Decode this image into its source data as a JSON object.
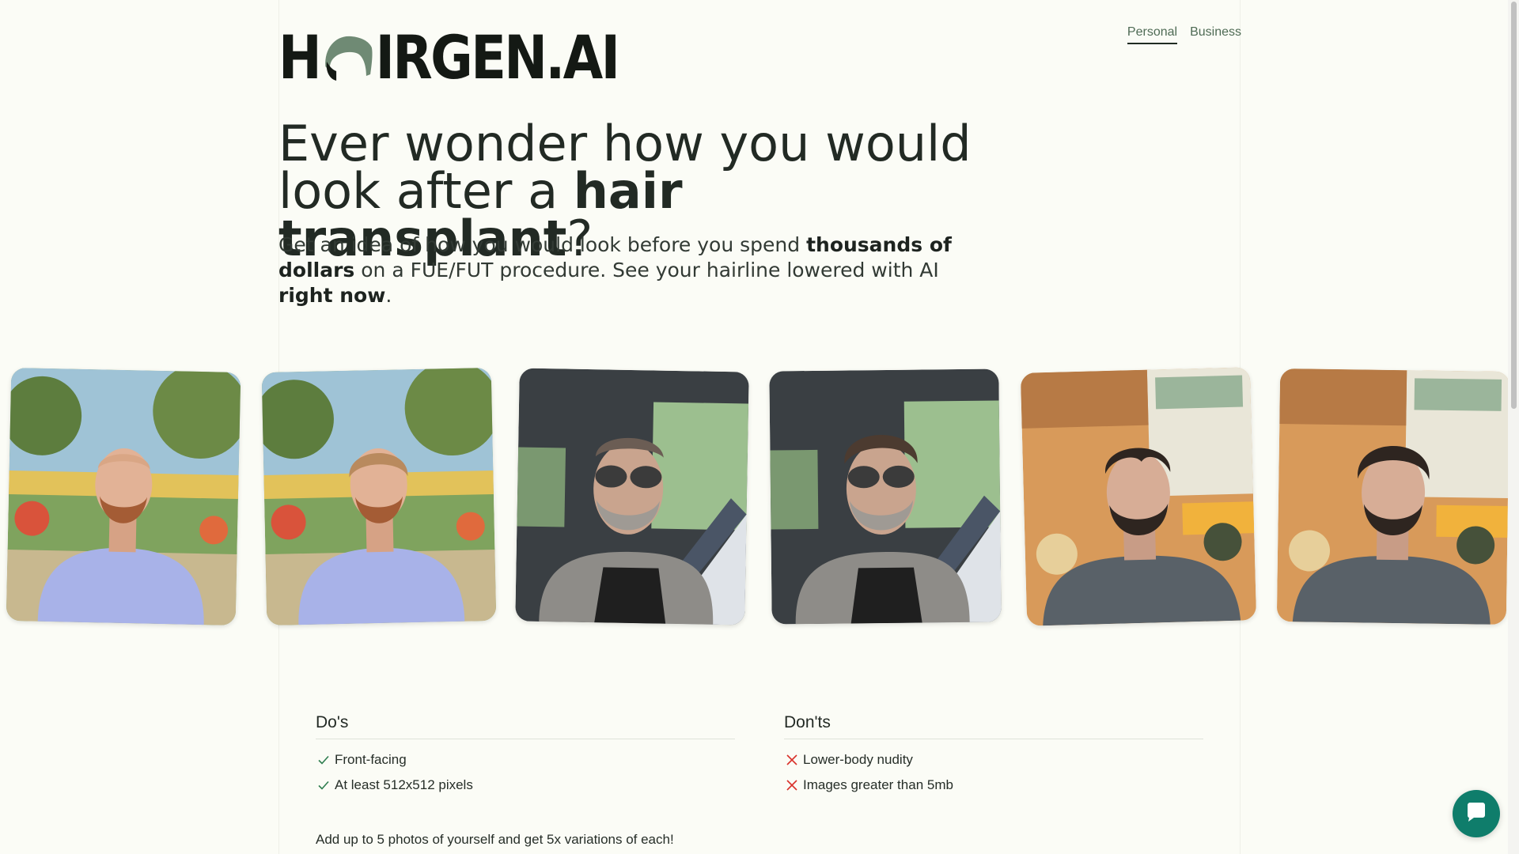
{
  "brand": {
    "logo_left": "H",
    "logo_right": "IRGEN.AI",
    "logo_text": "HAIRGEN.AI",
    "hair_color": "#6f8a74"
  },
  "nav": {
    "personal": "Personal",
    "business": "Business",
    "active": "Personal"
  },
  "hero": {
    "headline_line1": "Ever wonder how you would",
    "headline_line2_pre": "look after a ",
    "headline_line2_bold": "hair transplant",
    "headline_line2_post": "?",
    "sub_part1": "Get an idea of how you would look before you spend ",
    "sub_bold1": "thousands of dollars",
    "sub_part2": " on a FUE/FUT procedure. See your hairline lowered with AI ",
    "sub_bold2": "right now",
    "sub_part3": "."
  },
  "gallery": {
    "items": [
      {
        "subject": "man-blue-shirt",
        "state": "before"
      },
      {
        "subject": "man-blue-shirt",
        "state": "after"
      },
      {
        "subject": "man-sunglasses-car",
        "state": "before"
      },
      {
        "subject": "man-sunglasses-car",
        "state": "after"
      },
      {
        "subject": "man-restaurant",
        "state": "before"
      },
      {
        "subject": "man-restaurant",
        "state": "after"
      }
    ]
  },
  "dos": {
    "title": "Do's",
    "items": [
      "Front-facing",
      "At least 512x512 pixels"
    ],
    "icon": "check-icon",
    "color": "#2e7d4f"
  },
  "donts": {
    "title": "Don'ts",
    "items": [
      "Lower-body nudity",
      "Images greater than 5mb"
    ],
    "icon": "x-icon",
    "color": "#d9322b"
  },
  "footer": {
    "upload_hint": "Add up to 5 photos of yourself and get 5x variations of each!"
  },
  "chat": {
    "icon": "chat-bubble-icon",
    "color": "#0f7d6b"
  }
}
